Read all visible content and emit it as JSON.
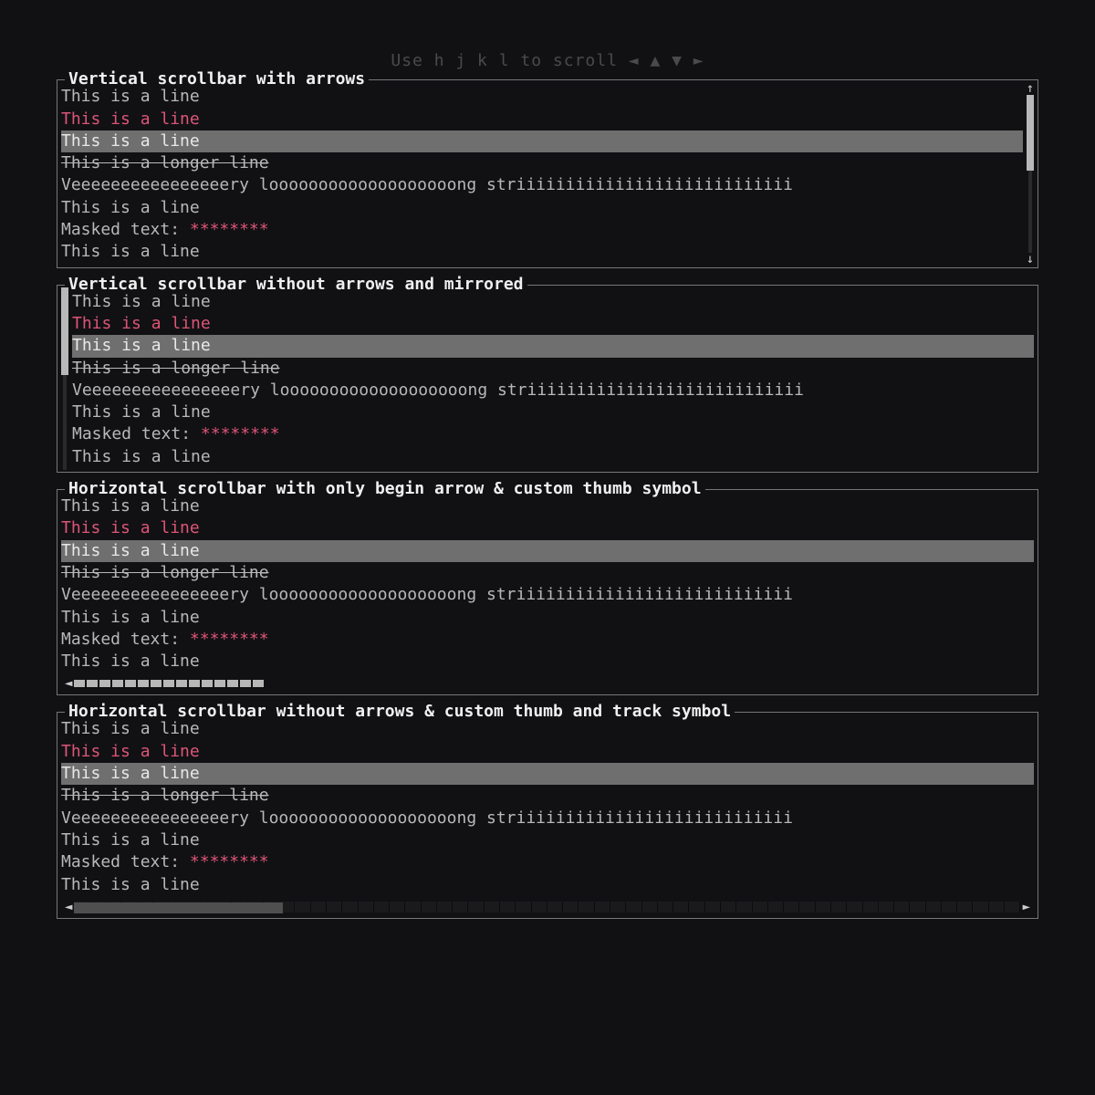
{
  "hint": "Use h j k l to scroll ◄ ▲ ▼ ►",
  "panels": [
    {
      "title": "Vertical scrollbar with arrows"
    },
    {
      "title": "Vertical scrollbar without arrows and mirrored"
    },
    {
      "title": "Horizontal scrollbar with only begin arrow & custom thumb symbol"
    },
    {
      "title": "Horizontal scrollbar without arrows & custom thumb and track symbol"
    }
  ],
  "common_lines": {
    "l0": "This is a line",
    "l1": "This is a line",
    "l2": "This is a line",
    "l3": "This is a longer line",
    "l4": "Veeeeeeeeeeeeeeeery    looooooooooooooooooong    striiiiiiiiiiiiiiiiiiiiiiiiiiii",
    "l5": "This is a line",
    "masked_label": "Masked text: ",
    "masked_value": "********",
    "l7": "This is a line"
  },
  "arrows": {
    "up": "↑",
    "down": "↓",
    "left": "◄",
    "right": "►"
  }
}
